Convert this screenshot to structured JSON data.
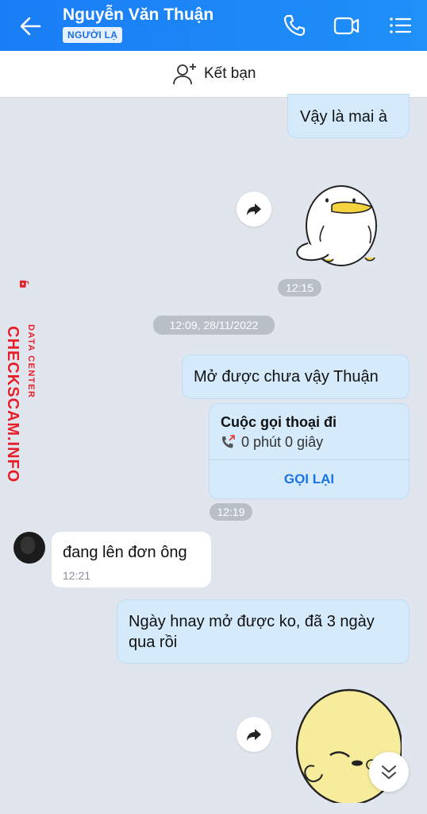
{
  "header": {
    "contact_name": "Nguyễn Văn Thuận",
    "badge": "NGƯỜI LẠ"
  },
  "friend_bar": {
    "label": "Kết bạn"
  },
  "messages": {
    "out_1": "Vậy là mai à",
    "sticker_1_time": "12:15",
    "date_separator": "12:09, 28/11/2022",
    "out_2": "Mở được chưa vậy Thuận",
    "call": {
      "title": "Cuộc gọi thoại đi",
      "duration": "0 phút 0 giây",
      "action": "GỌI LẠI",
      "time": "12:19"
    },
    "in_1": {
      "text": "đang lên đơn ông",
      "time": "12:21"
    },
    "out_3": "Ngày hnay mở được ko, đã 3 ngày qua rồi"
  },
  "watermark": {
    "main": "CHECKSCAM.INFO",
    "sub": "DATA CENTER"
  },
  "colors": {
    "header_blue": "#1a7df5",
    "bubble_out": "#d5ebfc",
    "chat_bg": "#e1e6ee",
    "watermark_red": "#e5202a"
  }
}
